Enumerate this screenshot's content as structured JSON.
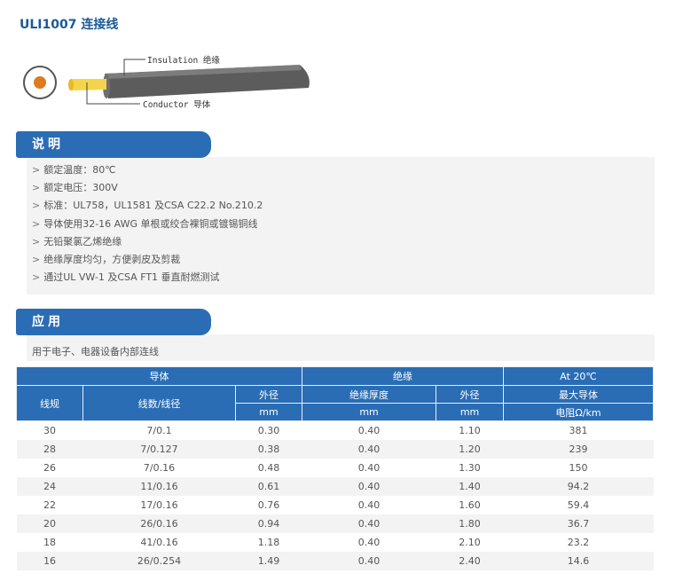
{
  "title": "ULI1007 连接线",
  "diagram": {
    "insulation_label": "Insulation 绝缘",
    "conductor_label": "Conductor 导体"
  },
  "description": {
    "heading": "说明",
    "marker": ">",
    "items": [
      "额定温度：80℃",
      "额定电压：300V",
      "标准：UL758，UL1581 及CSA C22.2 No.210.2",
      "导体使用32-16 AWG 单根或绞合裸铜或镀锡铜线",
      "无铅聚氯乙烯绝缘",
      "绝缘厚度均匀，方便剥皮及剪裁",
      "通过UL VW-1 及CSA FT1 垂直耐燃测试"
    ]
  },
  "application": {
    "heading": "应用",
    "text": "用于电子、电器设备内部连线"
  },
  "table": {
    "group_conductor": "导体",
    "group_insulation": "绝缘",
    "group_resistance": "At 20℃",
    "col_gauge": "线规",
    "col_strands": "线数/线径",
    "col_cond_od": "外径",
    "col_thickness": "绝缘厚度",
    "col_ins_od": "外径",
    "col_max_cond": "最大导体",
    "unit_mm_1": "mm",
    "unit_mm_2": "mm",
    "unit_mm_3": "mm",
    "unit_resistance": "电阻Ω/km",
    "rows": [
      [
        "30",
        "7/0.1",
        "0.30",
        "0.40",
        "1.10",
        "381"
      ],
      [
        "28",
        "7/0.127",
        "0.38",
        "0.40",
        "1.20",
        "239"
      ],
      [
        "26",
        "7/0.16",
        "0.48",
        "0.40",
        "1.30",
        "150"
      ],
      [
        "24",
        "11/0.16",
        "0.61",
        "0.40",
        "1.40",
        "94.2"
      ],
      [
        "22",
        "17/0.16",
        "0.76",
        "0.40",
        "1.60",
        "59.4"
      ],
      [
        "20",
        "26/0.16",
        "0.94",
        "0.40",
        "1.80",
        "36.7"
      ],
      [
        "18",
        "41/0.16",
        "1.18",
        "0.40",
        "2.10",
        "23.2"
      ],
      [
        "16",
        "26/0.254",
        "1.49",
        "0.40",
        "2.40",
        "14.6"
      ]
    ]
  },
  "colors": {
    "accent_blue": "#2a6db5",
    "title_blue": "#1a5a96",
    "panel_gray": "#f3f3f3",
    "conductor_orange": "#e07a1f",
    "conductor_yellow": "#f5d44a"
  }
}
